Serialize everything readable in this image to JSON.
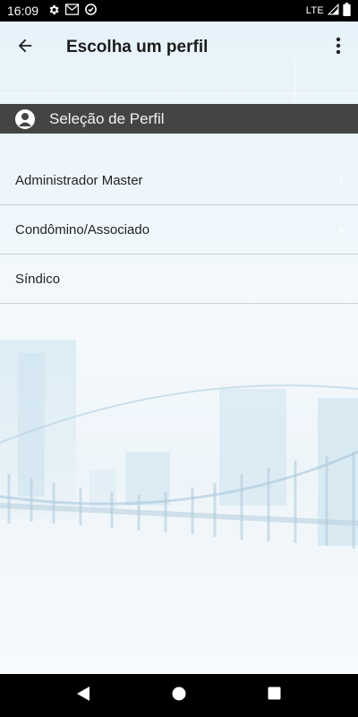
{
  "status_bar": {
    "time": "16:09",
    "network": "LTE",
    "icons": [
      "gear-icon",
      "gmail-icon",
      "data-saver-icon",
      "signal-icon",
      "battery-icon"
    ]
  },
  "app_bar": {
    "title": "Escolha um perfil",
    "back_icon": "arrow-back-icon",
    "menu_icon": "more-vert-icon"
  },
  "section": {
    "title": "Seleção de Perfil",
    "icon": "person-icon"
  },
  "profiles": [
    {
      "label": "Administrador Master"
    },
    {
      "label": "Condômino/Associado"
    },
    {
      "label": "Síndico"
    }
  ],
  "chevron": "›",
  "nav_bar": {
    "icons": [
      "back-triangle-icon",
      "home-circle-icon",
      "recents-square-icon"
    ]
  },
  "colors": {
    "section_header_bg": "#444444",
    "status_bar_bg": "#000000",
    "nav_bar_bg": "#000000"
  }
}
